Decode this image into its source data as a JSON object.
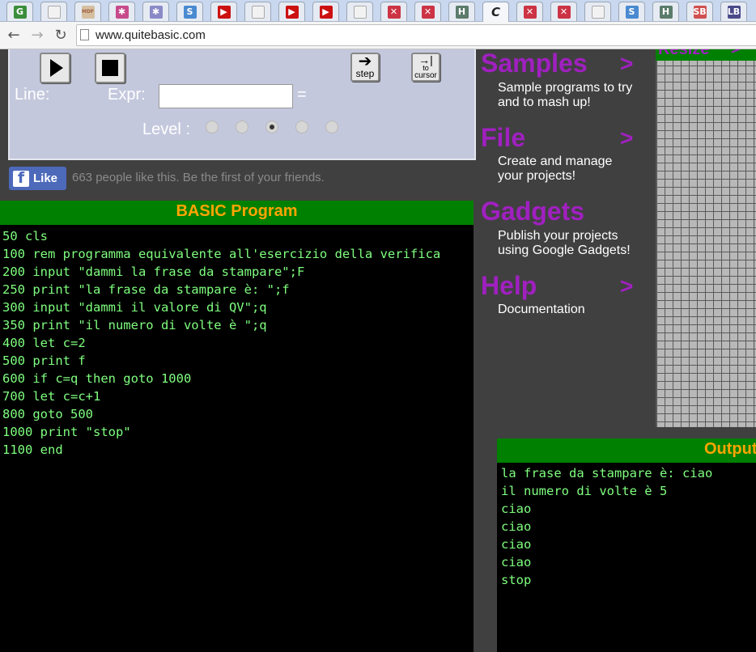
{
  "browser": {
    "tabs": [
      {
        "icon": "G",
        "color": "#3b8e3b",
        "name": "tab-google-g"
      },
      {
        "icon": "",
        "color": "#cccccc",
        "name": "tab-blank"
      },
      {
        "icon": "MDF",
        "color": "#d5bfa0",
        "name": "tab-mdf"
      },
      {
        "icon": "✱",
        "color": "#c74a8a",
        "name": "tab-pinwheel"
      },
      {
        "icon": "✱",
        "color": "#8a8ac7",
        "name": "tab-pinwheel-2"
      },
      {
        "icon": "S",
        "color": "#4a8ad0",
        "name": "tab-s"
      },
      {
        "icon": "▶",
        "color": "#cc1111",
        "name": "tab-youtube"
      },
      {
        "icon": "",
        "color": "#cccccc",
        "name": "tab-blank-2"
      },
      {
        "icon": "▶",
        "color": "#cc1111",
        "name": "tab-youtube-2"
      },
      {
        "icon": "▶",
        "color": "#cc1111",
        "name": "tab-youtube-3"
      },
      {
        "icon": "",
        "color": "#cccccc",
        "name": "tab-blank-3"
      },
      {
        "icon": "✕",
        "color": "#cc3344",
        "name": "tab-x"
      },
      {
        "icon": "✕",
        "color": "#cc3344",
        "name": "tab-x-2"
      },
      {
        "icon": "H",
        "color": "#5b7b6b",
        "name": "tab-h"
      },
      {
        "icon": "C",
        "color": "#222222",
        "name": "tab-c"
      },
      {
        "icon": "✕",
        "color": "#cc3344",
        "name": "tab-x-3"
      },
      {
        "icon": "✕",
        "color": "#cc3344",
        "name": "tab-x-4"
      },
      {
        "icon": "",
        "color": "#cccccc",
        "name": "tab-blank-4"
      },
      {
        "icon": "S",
        "color": "#4a8ad0",
        "name": "tab-s-2"
      },
      {
        "icon": "H",
        "color": "#5b7b6b",
        "name": "tab-h-2"
      },
      {
        "icon": "SB",
        "color": "#d05050",
        "name": "tab-sb"
      },
      {
        "icon": "LB",
        "color": "#4a4a8a",
        "name": "tab-lb"
      }
    ],
    "url": "www.quitebasic.com"
  },
  "debugger": {
    "line_label": "Line:",
    "expr_label": "Expr:",
    "expr_value": "",
    "equals": "=",
    "level_label": "Level :",
    "level_selected": 3,
    "level_count": 5,
    "step_label": "step",
    "to_cursor_label": "to",
    "to_cursor_label2": "cursor"
  },
  "social": {
    "like_label": "Like",
    "like_text": "663 people like this. Be the first of your friends."
  },
  "program": {
    "header": "BASIC Program",
    "lines": [
      "50 cls",
      "100 rem programma equivalente all'esercizio della verifica",
      "200 input \"dammi la frase da stampare\";F",
      "250 print \"la frase da stampare è: \";f",
      "300 input \"dammi il valore di QV\";q",
      "350 print \"il numero di volte è \";q",
      "400 let c=2",
      "500 print f",
      "600 if c=q then goto 1000",
      "700 let c=c+1",
      "800 goto 500",
      "1000 print \"stop\"",
      "1100 end"
    ]
  },
  "menu": {
    "samples_title": "Samples",
    "samples_desc1": "Sample programs to try",
    "samples_desc2": "and to mash up!",
    "file_title": "File",
    "file_desc1": "Create and manage",
    "file_desc2": "your projects!",
    "gadgets_title": "Gadgets",
    "gadgets_desc1": "Publish your projects",
    "gadgets_desc2": "using Google Gadgets!",
    "help_title": "Help",
    "help_desc": "Documentation",
    "arrow": ">"
  },
  "canvas": {
    "resize_label": "Resize",
    "resize_arrow": ">"
  },
  "output": {
    "header": "Output",
    "lines": [
      "la frase da stampare è: ciao",
      "il numero di volte è 5",
      "ciao",
      "ciao",
      "ciao",
      "ciao",
      "stop"
    ]
  }
}
